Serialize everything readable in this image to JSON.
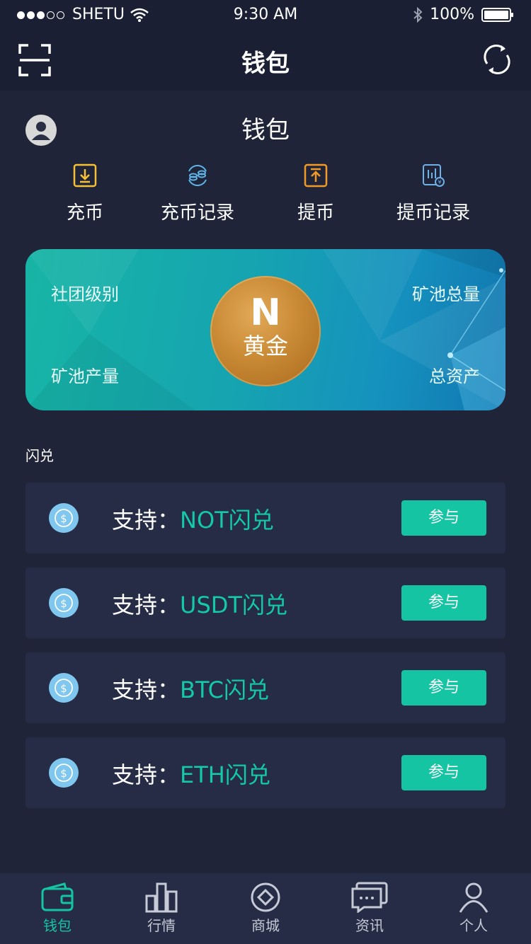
{
  "status_bar": {
    "carrier": "SHETU",
    "time": "9:30 AM",
    "battery": "100%"
  },
  "navbar": {
    "title": "钱包",
    "left_icon": "scan-icon",
    "right_icon": "refresh-icon"
  },
  "header": {
    "title": "钱包"
  },
  "actions": [
    {
      "label": "充币",
      "icon": "deposit-icon",
      "color": "#f6c137"
    },
    {
      "label": "充币记录",
      "icon": "deposit-record-icon",
      "color": "#5fb4e8"
    },
    {
      "label": "提币",
      "icon": "withdraw-icon",
      "color": "#f19a28"
    },
    {
      "label": "提币记录",
      "icon": "withdraw-record-icon",
      "color": "#6fb0e6"
    }
  ],
  "card": {
    "top_left": "社团级别",
    "top_right": "矿池总量",
    "bottom_left": "矿池产量",
    "bottom_right": "总资产",
    "medal_letter": "N",
    "medal_label": "黄金"
  },
  "section_title": "闪兑",
  "exchange_items": [
    {
      "prefix": "支持：",
      "coin": "NOT闪兑",
      "button": "参与"
    },
    {
      "prefix": "支持：",
      "coin": "USDT闪兑",
      "button": "参与"
    },
    {
      "prefix": "支持：",
      "coin": "BTC闪兑",
      "button": "参与"
    },
    {
      "prefix": "支持：",
      "coin": "ETH闪兑",
      "button": "参与"
    }
  ],
  "tabbar": [
    {
      "label": "钱包",
      "icon": "wallet-icon",
      "active": true
    },
    {
      "label": "行情",
      "icon": "chart-icon",
      "active": false
    },
    {
      "label": "商城",
      "icon": "shop-icon",
      "active": false
    },
    {
      "label": "资讯",
      "icon": "message-icon",
      "active": false
    },
    {
      "label": "个人",
      "icon": "person-icon",
      "active": false
    }
  ],
  "colors": {
    "accent": "#14c4a2",
    "background": "#1b1f33",
    "row_bg": "#262c45"
  }
}
